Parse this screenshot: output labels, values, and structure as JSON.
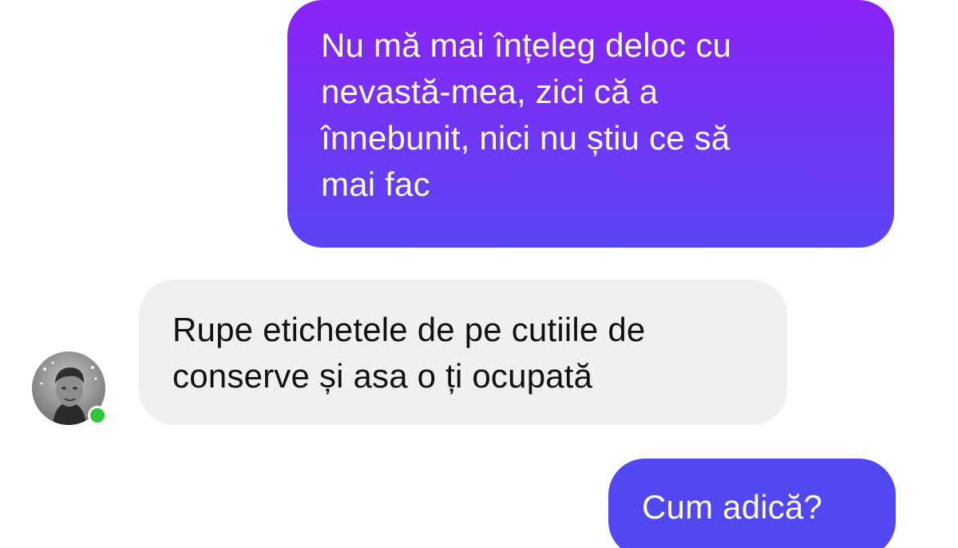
{
  "conversation": {
    "messages": [
      {
        "direction": "outgoing",
        "lines": [
          "Nu mă mai înțeleg deloc cu",
          "nevastă-mea, zici că a",
          "înnebunit, nici nu știu ce să",
          "mai fac"
        ]
      },
      {
        "direction": "incoming",
        "lines": [
          "Rupe etichetele de pe cutiile de",
          "conserve și asa o ți ocupată"
        ]
      },
      {
        "direction": "outgoing",
        "lines": [
          "Cum adică?"
        ]
      }
    ],
    "contact": {
      "avatar_icon": "user-avatar-photo",
      "presence_icon": "online-dot-icon",
      "online": true
    }
  },
  "colors": {
    "outgoing_gradient_top": "#8a22f7",
    "outgoing_gradient_bottom": "#5a45f3",
    "outgoing_solid": "#5248f2",
    "incoming_bg": "#f0f0f0",
    "online": "#31c83a"
  }
}
